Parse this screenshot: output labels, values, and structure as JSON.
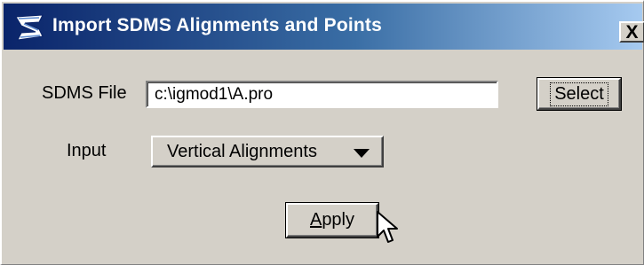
{
  "window": {
    "title": "Import SDMS Alignments and Points",
    "icon": "app-logo-icon",
    "close_label": "X"
  },
  "form": {
    "file_label": "SDMS  File",
    "file_value": "c:\\igmod1\\A.pro",
    "select_button_label": "Select",
    "input_label": "Input",
    "input_selected": "Vertical Alignments",
    "apply_prefix": "A",
    "apply_rest": "pply"
  },
  "colors": {
    "dialog_background": "#d4d0c8",
    "title_gradient_start": "#0a246a",
    "title_gradient_end": "#a6caf0",
    "title_text": "#ffffff"
  }
}
